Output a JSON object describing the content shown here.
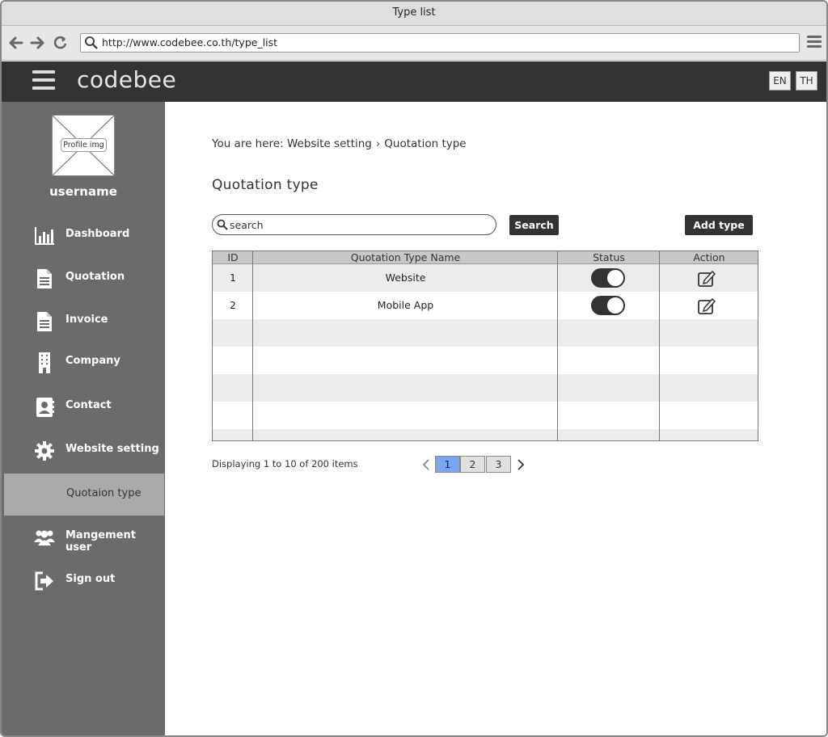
{
  "browser": {
    "window_title": "Type list",
    "url": "http://www.codebee.co.th/type_list"
  },
  "appbar": {
    "logo": "codebee",
    "lang_en": "EN",
    "lang_th": "TH"
  },
  "sidebar": {
    "profile_img_label": "Profile img",
    "username": "username",
    "items": [
      {
        "label": "Dashboard",
        "icon": "bar-chart-icon"
      },
      {
        "label": "Quotation",
        "icon": "document-icon"
      },
      {
        "label": "Invoice",
        "icon": "document-icon"
      },
      {
        "label": "Company",
        "icon": "building-icon"
      },
      {
        "label": "Contact",
        "icon": "contact-card-icon"
      },
      {
        "label": "Website setting",
        "icon": "gear-icon"
      },
      {
        "label": "Quotaion type",
        "icon": ""
      },
      {
        "label": "Mangement user",
        "icon": "users-icon"
      },
      {
        "label": "Sign out",
        "icon": "sign-out-icon"
      }
    ]
  },
  "main": {
    "breadcrumb": {
      "prefix": "You are here:",
      "parent": "Website setting",
      "current": "Quotation type"
    },
    "title": "Quotation type",
    "search": {
      "placeholder": "search",
      "value": "",
      "button": "Search"
    },
    "add_button": "Add type",
    "table": {
      "columns": [
        "ID",
        "Quotation Type Name",
        "Status",
        "Action"
      ],
      "rows": [
        {
          "id": "1",
          "name": "Website",
          "status": "on"
        },
        {
          "id": "2",
          "name": "Mobile App",
          "status": "on"
        }
      ]
    },
    "pagination": {
      "summary": "Displaying 1 to 10 of 200 items",
      "pages": [
        "1",
        "2",
        "3"
      ],
      "current": "1"
    }
  },
  "colors": {
    "appbar": "#333333",
    "sidebar": "#6b6b6b",
    "sidebar_active": "#aaaaaa",
    "page_active": "#7aa6f0"
  }
}
